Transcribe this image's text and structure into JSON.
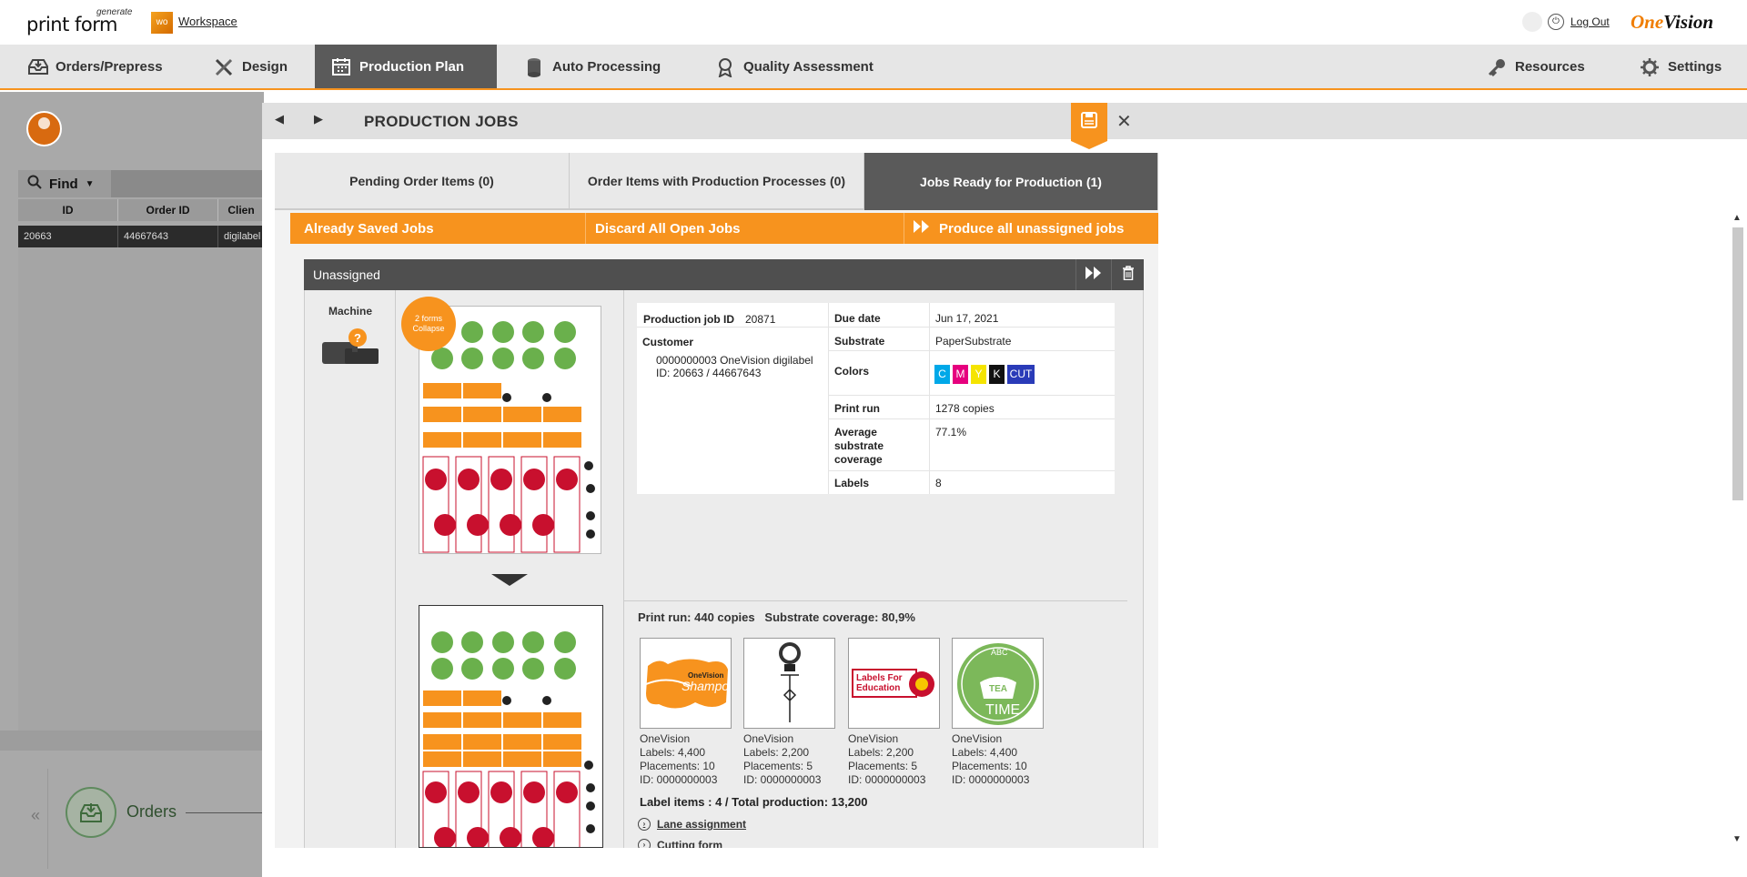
{
  "header": {
    "logo": "print form",
    "logo_sup": "generate",
    "workspace_icon": "wo",
    "workspace_link": "Workspace",
    "logout_link": "Log Out",
    "brand_one": "One",
    "brand_vision": "Vision"
  },
  "nav": {
    "items": [
      {
        "label": "Orders/Prepress",
        "icon": "inbox-icon"
      },
      {
        "label": "Design",
        "icon": "design-tools-icon"
      },
      {
        "label": "Production Plan",
        "icon": "calendar-icon",
        "active": true
      },
      {
        "label": "Auto Processing",
        "icon": "roll-icon"
      },
      {
        "label": "Quality Assessment",
        "icon": "award-icon"
      }
    ],
    "right": [
      {
        "label": "Resources",
        "icon": "key-icon"
      },
      {
        "label": "Settings",
        "icon": "gear-icon"
      }
    ]
  },
  "background": {
    "find_label": "Find",
    "columns": [
      "ID",
      "Order ID",
      "Clien"
    ],
    "row": [
      "20663",
      "44667643",
      "digilabel"
    ],
    "orders_label": "Orders"
  },
  "modal": {
    "title": "PRODUCTION JOBS",
    "tabs": [
      {
        "label": "Pending Order Items (0)"
      },
      {
        "label": "Order Items with Production Processes (0)"
      },
      {
        "label": "Jobs Ready for Production (1)",
        "active": true
      }
    ],
    "actions": {
      "already_saved": "Already Saved Jobs",
      "discard_all": "Discard All Open Jobs",
      "produce_all": "Produce all unassigned jobs"
    },
    "group_title": "Unassigned",
    "machine_label": "Machine",
    "forms_badge_line1": "2 forms",
    "forms_badge_line2": "Collapse",
    "details": {
      "job_id_label": "Production job ID",
      "job_id": "20871",
      "customer_label": "Customer",
      "customer_line1": "0000000003 OneVision digilabel",
      "customer_line2": "ID: 20663 / 44667643",
      "due_date_label": "Due date",
      "due_date": "Jun 17, 2021",
      "substrate_label": "Substrate",
      "substrate": "PaperSubstrate",
      "colors_label": "Colors",
      "colors": [
        {
          "label": "C",
          "color": "#00a8e8"
        },
        {
          "label": "M",
          "color": "#e6007e"
        },
        {
          "label": "Y",
          "color": "#f5e400"
        },
        {
          "label": "K",
          "color": "#111111"
        },
        {
          "label": "CUT",
          "color": "#2a3bb8"
        }
      ],
      "print_run_label": "Print run",
      "print_run": "1278 copies",
      "avg_cov_label_1": "Average",
      "avg_cov_label_2": "substrate",
      "avg_cov_label_3": "coverage",
      "avg_cov": "77.1%",
      "labels_label": "Labels",
      "labels": "8"
    },
    "form": {
      "print_run_line": "Print run: 440 copies   Substrate coverage: 80,9%",
      "items": [
        {
          "name": "OneVision",
          "labels": "Labels: 4,400",
          "placements": "Placements: 10",
          "id": "ID: 0000000003",
          "art": "shampoo"
        },
        {
          "name": "OneVision",
          "labels": "Labels: 2,200",
          "placements": "Placements: 5",
          "id": "ID: 0000000003",
          "art": "bottle"
        },
        {
          "name": "OneVision",
          "labels": "Labels: 2,200",
          "placements": "Placements: 5",
          "id": "ID: 0000000003",
          "art": "education"
        },
        {
          "name": "OneVision",
          "labels": "Labels: 4,400",
          "placements": "Placements: 10",
          "id": "ID: 0000000003",
          "art": "tea"
        }
      ],
      "totals": "Label items : 4 / Total production: 13,200",
      "lane_assignment": "Lane assignment",
      "cutting_form": "Cutting form"
    },
    "thumb_text": {
      "shampoo_brand": "OneVision",
      "shampoo": "Shampoo",
      "edu_line1": "Labels For",
      "edu_line2": "Education",
      "tea_abc": "ABC",
      "tea_line1": "TEA",
      "tea_line2": "TIME"
    }
  }
}
